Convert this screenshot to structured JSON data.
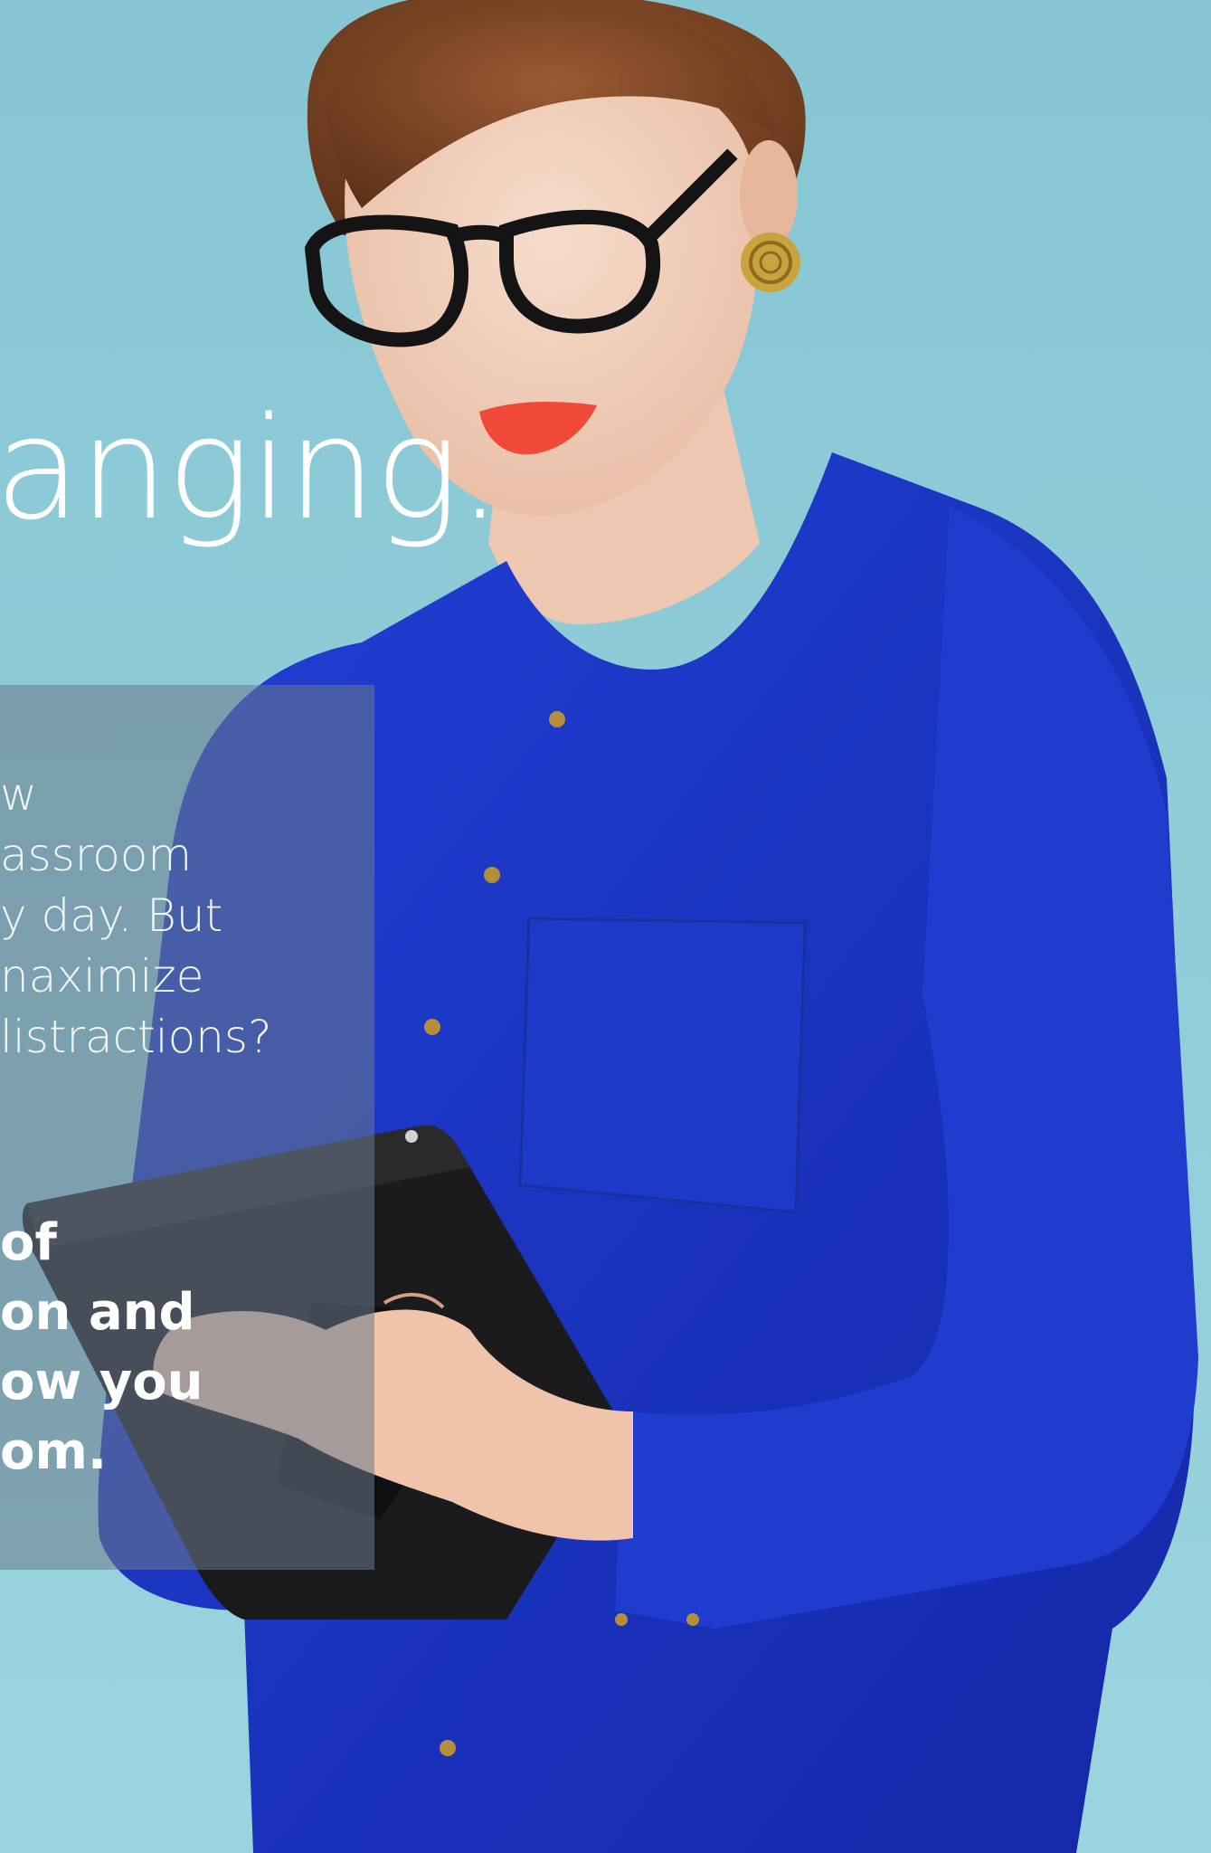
{
  "headline": "anging.",
  "body_light_lines": [
    "w",
    "assroom",
    "y day. But",
    "naximize",
    "listractions?"
  ],
  "body_bold_lines": [
    "of",
    "on and",
    "ow you",
    "om."
  ],
  "colors": {
    "background": "#8fcdd9",
    "shirt": "#1a34c8",
    "tablet": "#1b1b1d",
    "text": "#ffffff"
  }
}
